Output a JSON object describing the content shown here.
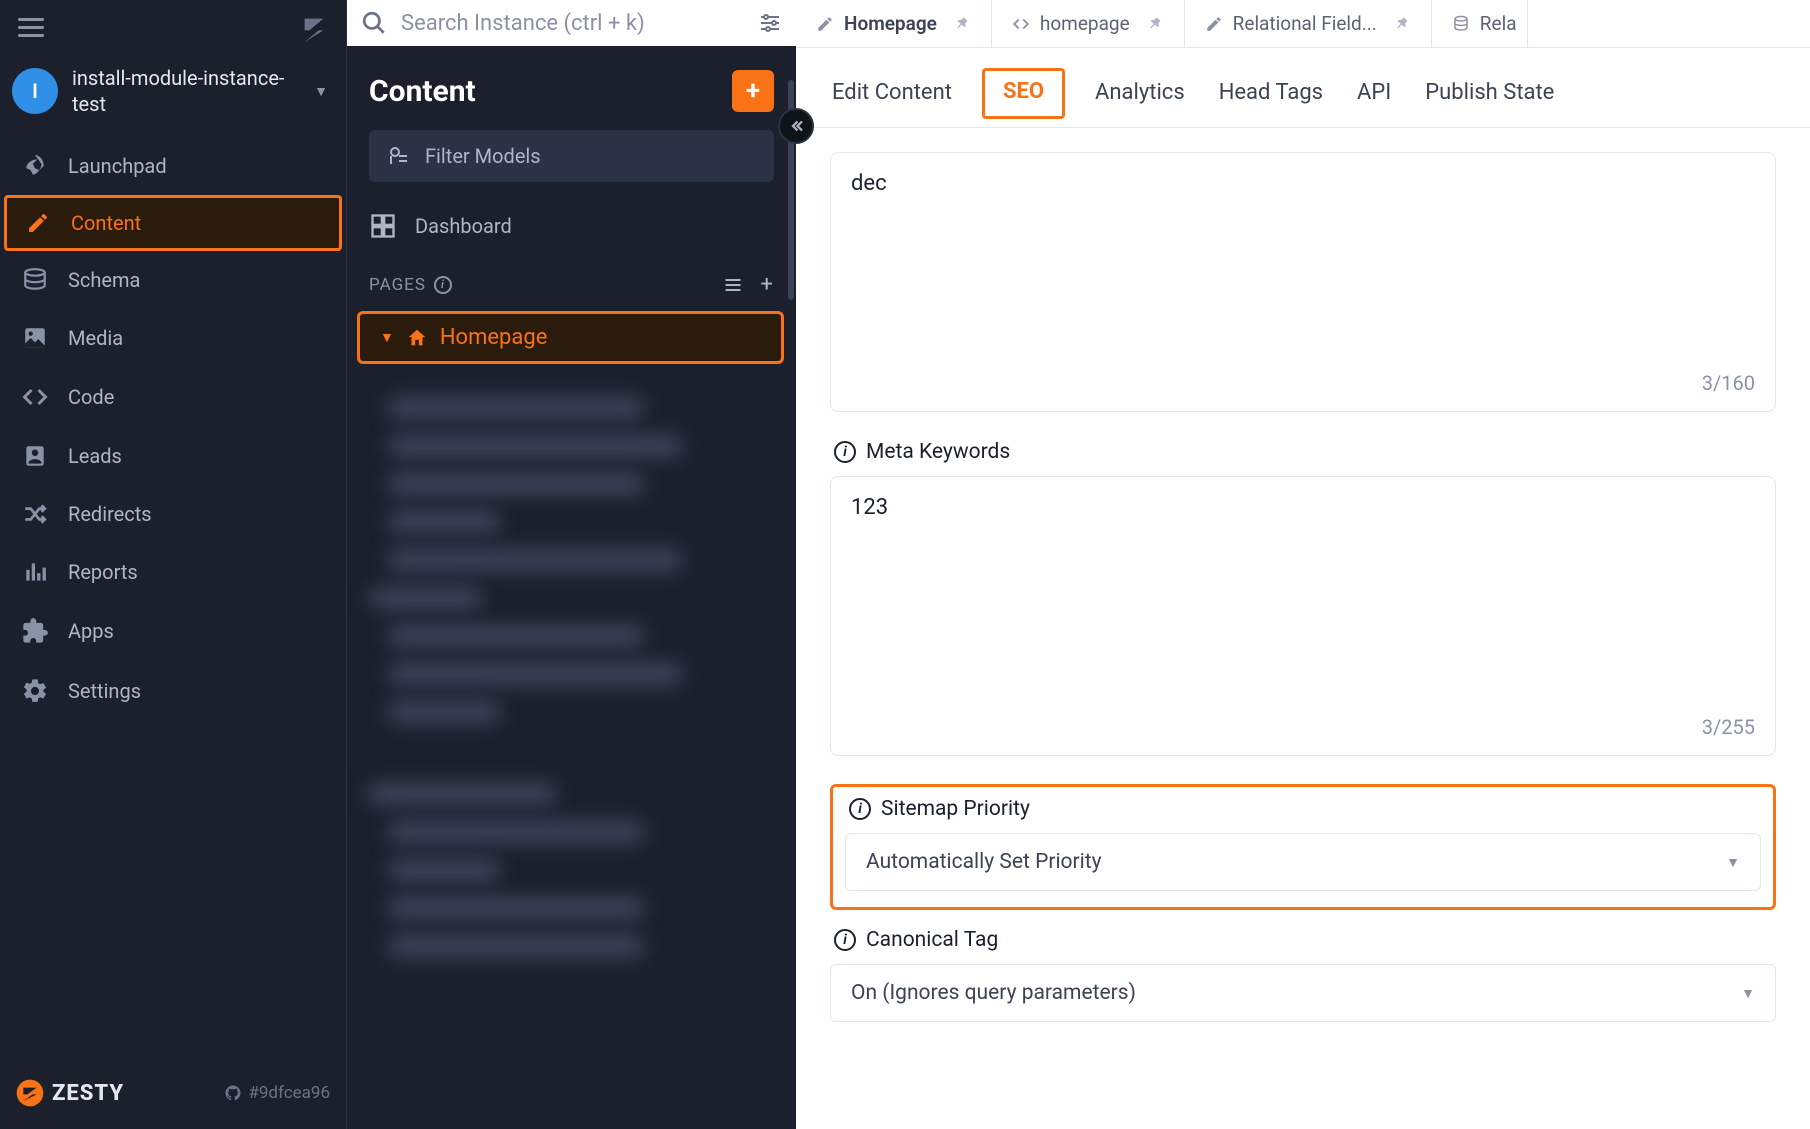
{
  "sidebar": {
    "instance_name": "install-module-instance-test",
    "avatar_initial": "I",
    "items": [
      {
        "label": "Launchpad"
      },
      {
        "label": "Content"
      },
      {
        "label": "Schema"
      },
      {
        "label": "Media"
      },
      {
        "label": "Code"
      },
      {
        "label": "Leads"
      },
      {
        "label": "Redirects"
      },
      {
        "label": "Reports"
      },
      {
        "label": "Apps"
      },
      {
        "label": "Settings"
      }
    ],
    "commit_hash": "#9dfcea96",
    "brand": "ZESTY"
  },
  "content_panel": {
    "search_placeholder": "Search Instance (ctrl + k)",
    "title": "Content",
    "filter_label": "Filter Models",
    "dashboard_label": "Dashboard",
    "section_label": "PAGES",
    "pages": [
      {
        "label": "Homepage"
      }
    ]
  },
  "tabs": [
    {
      "label": "Homepage",
      "icon": "pencil",
      "active": true
    },
    {
      "label": "homepage",
      "icon": "code",
      "active": false
    },
    {
      "label": "Relational Field...",
      "icon": "pencil",
      "active": false
    },
    {
      "label": "Rela",
      "icon": "db",
      "active": false
    }
  ],
  "subtabs": {
    "items": [
      "Edit Content",
      "SEO",
      "Analytics",
      "Head Tags",
      "API",
      "Publish State"
    ],
    "active": "SEO"
  },
  "seo": {
    "meta_desc_value": "dec",
    "meta_desc_counter": "3/160",
    "meta_keywords_label": "Meta Keywords",
    "meta_keywords_value": "123",
    "meta_keywords_counter": "3/255",
    "sitemap_label": "Sitemap Priority",
    "sitemap_value": "Automatically Set Priority",
    "canonical_label": "Canonical Tag",
    "canonical_value": "On (Ignores query parameters)"
  }
}
